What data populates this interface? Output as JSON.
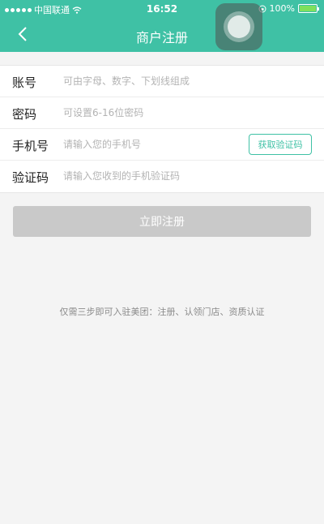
{
  "status_bar": {
    "carrier": "中国联通",
    "time": "16:52",
    "battery": "100%",
    "battery_level": 1.0
  },
  "nav": {
    "title": "商户注册",
    "back_icon": "chevron-left-icon"
  },
  "form": {
    "account": {
      "label": "账号",
      "placeholder": "可由字母、数字、下划线组成"
    },
    "password": {
      "label": "密码",
      "placeholder": "可设置6-16位密码"
    },
    "phone": {
      "label": "手机号",
      "placeholder": "请输入您的手机号",
      "code_button": "获取验证码"
    },
    "code": {
      "label": "验证码",
      "placeholder": "请输入您收到的手机验证码"
    }
  },
  "register_button": "立即注册",
  "hint": "仅需三步即可入驻美团：注册、认领门店、资质认证",
  "colors": {
    "accent": "#3fc1a5",
    "button_disabled": "#c9c9c9",
    "background": "#f4f4f4"
  }
}
